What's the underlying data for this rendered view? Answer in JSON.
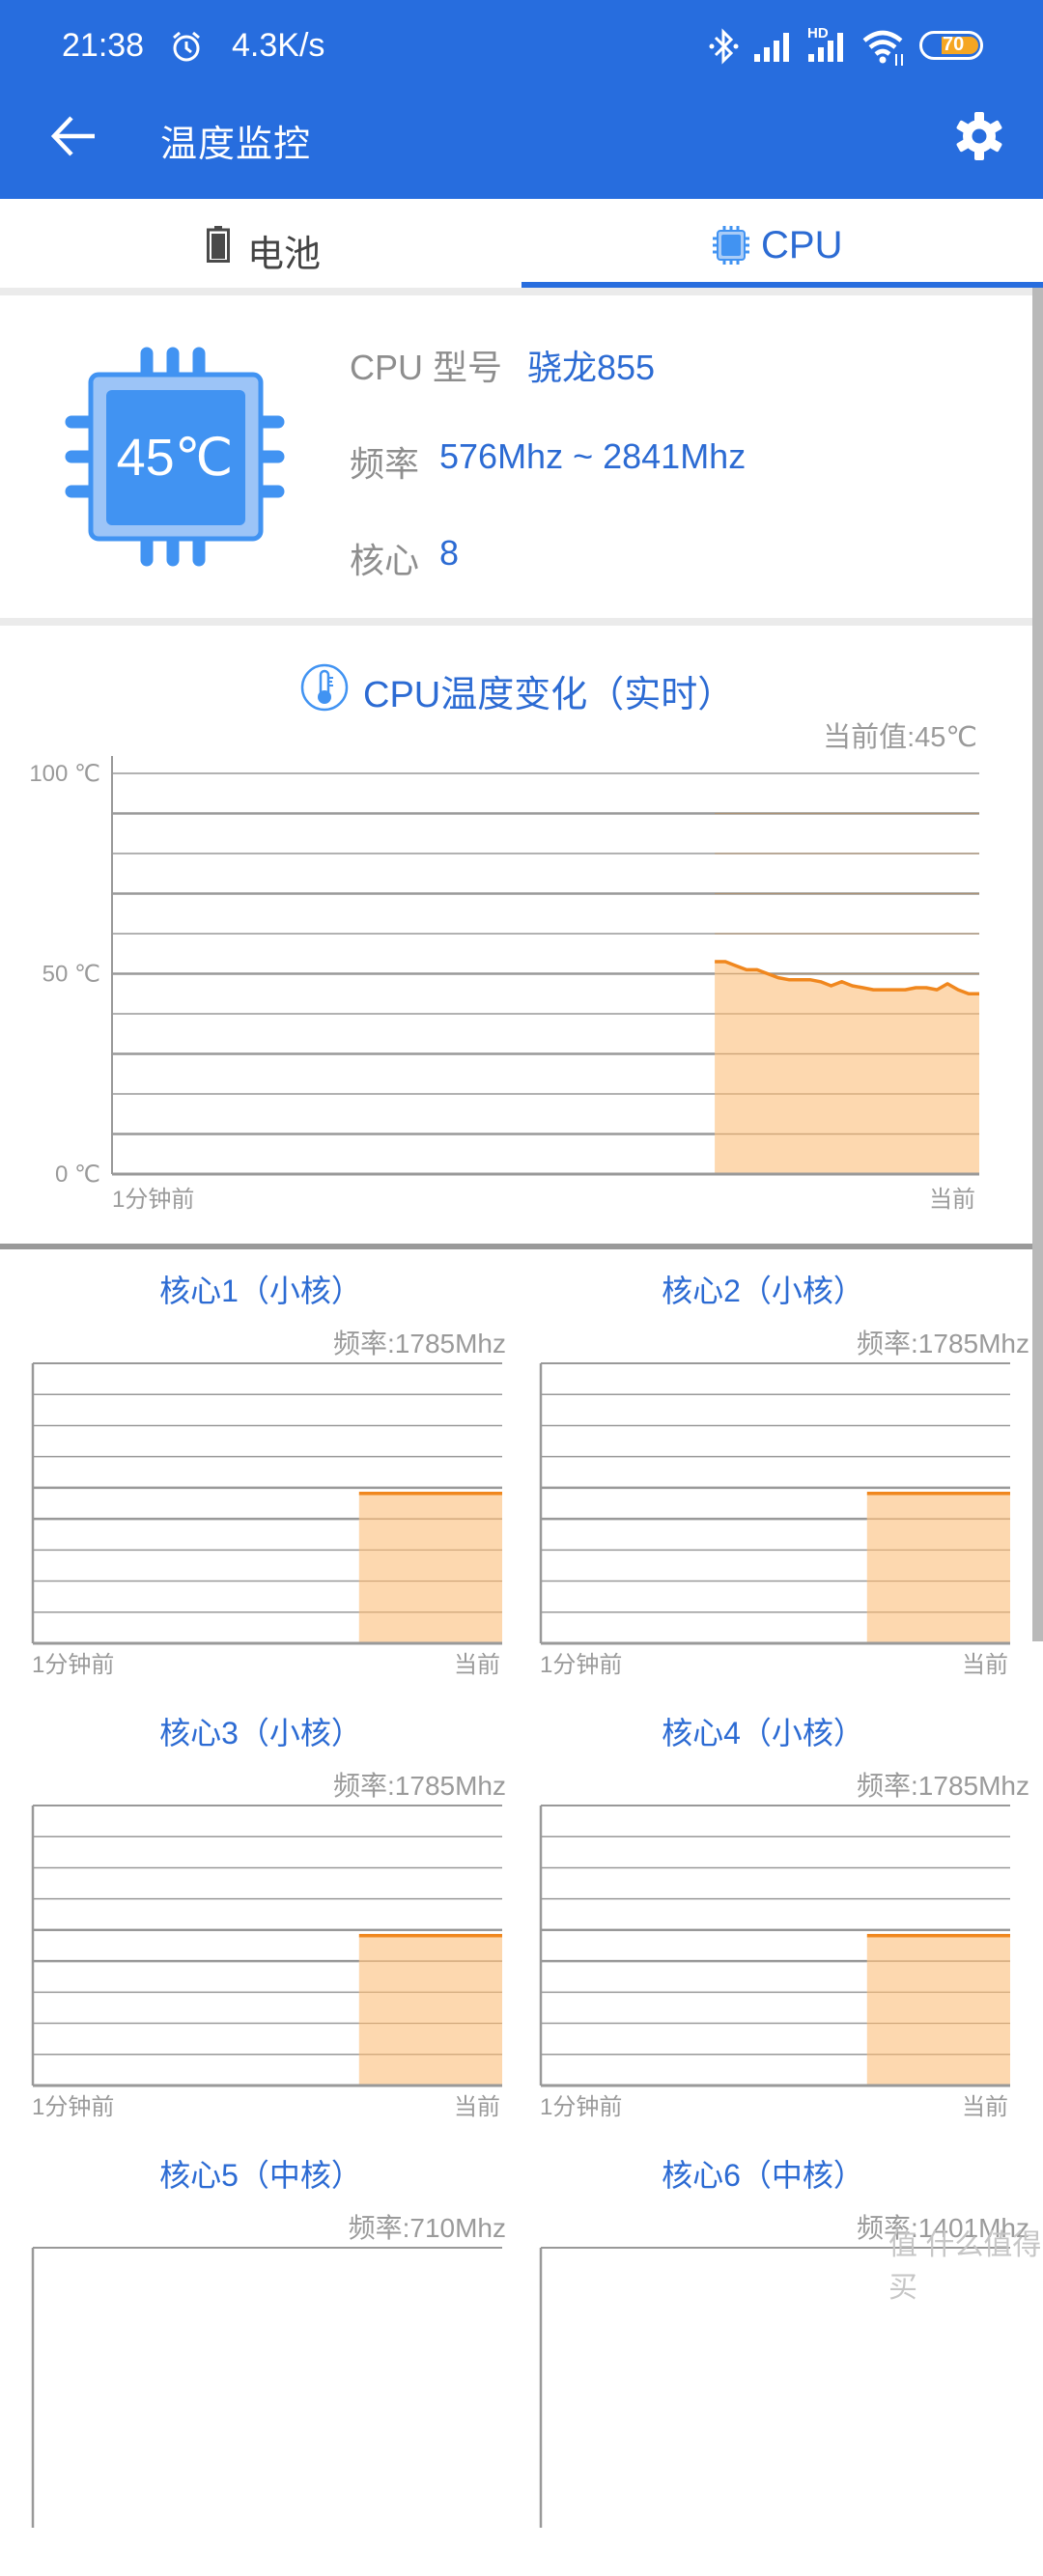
{
  "status_bar": {
    "time": "21:38",
    "net_speed": "4.3K/s",
    "battery_level": "70",
    "hd_label": "HD",
    "icons": [
      "alarm-icon",
      "bluetooth-icon",
      "signal-icon",
      "hd-signal-icon",
      "wifi-icon",
      "battery-icon"
    ]
  },
  "app_bar": {
    "title": "温度监控",
    "back_icon": "arrow-left-icon",
    "settings_icon": "gear-icon"
  },
  "tabs": [
    {
      "label": "电池",
      "icon": "battery-icon",
      "active": false
    },
    {
      "label": "CPU",
      "icon": "cpu-chip-icon",
      "active": true
    }
  ],
  "colors": {
    "brand_blue": "#276DDE",
    "accent_blue": "#2c6bd3",
    "chip_blue": "#4193F2",
    "orange_line": "#F0871E",
    "orange_fill": "#FDD5A8"
  },
  "cpu_info": {
    "chip_temp": "45℃",
    "rows": [
      {
        "label": "CPU 型号",
        "value": "骁龙855"
      },
      {
        "label": "频率",
        "value": "576Mhz ~ 2841Mhz"
      },
      {
        "label": "核心",
        "value": "8"
      }
    ]
  },
  "temp_chart_section": {
    "title": "CPU温度变化（实时）",
    "current_value": "当前值:45℃"
  },
  "chart_data": [
    {
      "type": "area",
      "title": "CPU温度变化（实时）",
      "xlabel": "",
      "ylabel": "",
      "x_start_label": "1分钟前",
      "x_end_label": "当前",
      "y_tick_labels": [
        "100 ℃",
        "50 ℃",
        "0 ℃"
      ],
      "ylim": [
        0,
        100
      ],
      "grid": true,
      "grid_lines": 10,
      "data_start_fraction": 0.695,
      "series": [
        {
          "name": "CPU温度",
          "values": [
            53,
            53,
            52,
            51,
            51,
            50,
            49,
            48.5,
            48.5,
            48.5,
            48,
            47,
            48,
            47,
            46.5,
            46,
            46,
            46,
            46,
            46.5,
            46.5,
            46,
            47.5,
            46,
            45,
            45
          ]
        }
      ]
    },
    {
      "type": "area",
      "title": "核心1（小核）",
      "freq": "频率:1785Mhz",
      "x_start_label": "1分钟前",
      "x_end_label": "当前",
      "grid": true,
      "grid_lines": 9,
      "data_start_fraction": 0.695,
      "series": [
        {
          "name": "core1",
          "values_fraction": [
            0.535,
            0.535
          ]
        }
      ]
    },
    {
      "type": "area",
      "title": "核心2（小核）",
      "freq": "频率:1785Mhz",
      "x_start_label": "1分钟前",
      "x_end_label": "当前",
      "grid": true,
      "grid_lines": 9,
      "data_start_fraction": 0.695,
      "series": [
        {
          "name": "core2",
          "values_fraction": [
            0.535,
            0.535
          ]
        }
      ]
    },
    {
      "type": "area",
      "title": "核心3（小核）",
      "freq": "频率:1785Mhz",
      "x_start_label": "1分钟前",
      "x_end_label": "当前",
      "grid": true,
      "grid_lines": 9,
      "data_start_fraction": 0.695,
      "series": [
        {
          "name": "core3",
          "values_fraction": [
            0.535,
            0.535
          ]
        }
      ]
    },
    {
      "type": "area",
      "title": "核心4（小核）",
      "freq": "频率:1785Mhz",
      "x_start_label": "1分钟前",
      "x_end_label": "当前",
      "grid": true,
      "grid_lines": 9,
      "data_start_fraction": 0.695,
      "series": [
        {
          "name": "core4",
          "values_fraction": [
            0.535,
            0.535
          ]
        }
      ]
    },
    {
      "type": "area",
      "title": "核心5（中核）",
      "freq": "频率:710Mhz",
      "grid": true
    },
    {
      "type": "area",
      "title": "核心6（中核）",
      "freq": "频率:1401Mhz",
      "grid": true
    }
  ],
  "watermark": "值 什么值得买"
}
